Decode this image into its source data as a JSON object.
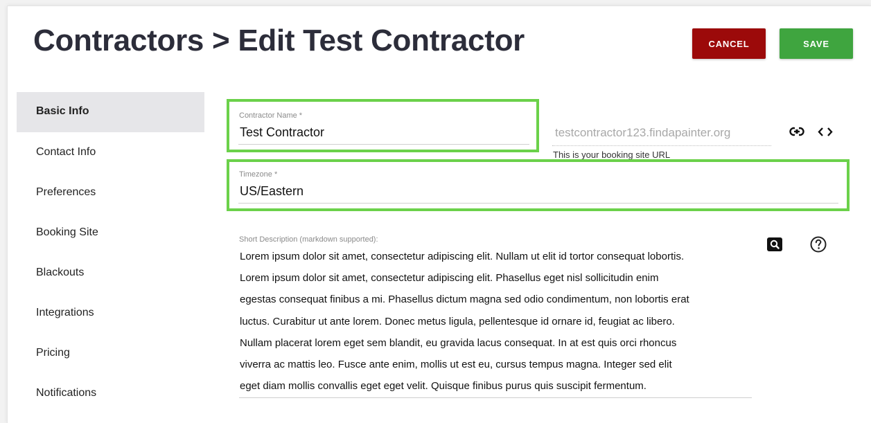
{
  "header": {
    "title": "Contractors > Edit Test Contractor",
    "cancel_label": "CANCEL",
    "save_label": "SAVE"
  },
  "sidebar": {
    "items": [
      {
        "label": "Basic Info",
        "active": true
      },
      {
        "label": "Contact Info"
      },
      {
        "label": "Preferences"
      },
      {
        "label": "Booking Site"
      },
      {
        "label": "Blackouts"
      },
      {
        "label": "Integrations"
      },
      {
        "label": "Pricing"
      },
      {
        "label": "Notifications"
      }
    ]
  },
  "form": {
    "contractor_name": {
      "label": "Contractor Name *",
      "value": "Test Contractor"
    },
    "booking_url": {
      "value": "testcontractor123.findapainter.org",
      "hint": "This is your booking site URL"
    },
    "timezone": {
      "label": "Timezone *",
      "value": "US/Eastern"
    },
    "short_description": {
      "label": "Short Description (markdown supported):",
      "lines": [
        "Lorem ipsum dolor sit amet, consectetur adipiscing elit. Nullam ut elit id tortor consequat lobortis.",
        "Lorem ipsum dolor sit amet, consectetur adipiscing elit. Phasellus eget nisl sollicitudin enim",
        "egestas consequat finibus a mi. Phasellus dictum magna sed odio condimentum, non lobortis erat",
        "luctus. Curabitur ut ante lorem. Donec metus ligula, pellentesque id ornare id, feugiat ac libero.",
        "Nullam placerat lorem eget sem blandit, eu gravida lacus consequat. In at est quis orci rhoncus",
        "viverra ac mattis leo. Fusce ante enim, mollis ut est eu, cursus tempus magna. Integer sed elit",
        "eget diam mollis convallis eget eget velit. Quisque finibus purus quis suscipit fermentum."
      ]
    }
  },
  "icons": {
    "link": "link-icon",
    "embed": "code-icon",
    "preview": "search-icon",
    "help": "help-icon"
  },
  "colors": {
    "cancel": "#9c0a0a",
    "save": "#3fa53f",
    "highlight": "#6bd14a",
    "title": "#2c2d3a",
    "active_tab_bg": "#e6e6e9"
  }
}
